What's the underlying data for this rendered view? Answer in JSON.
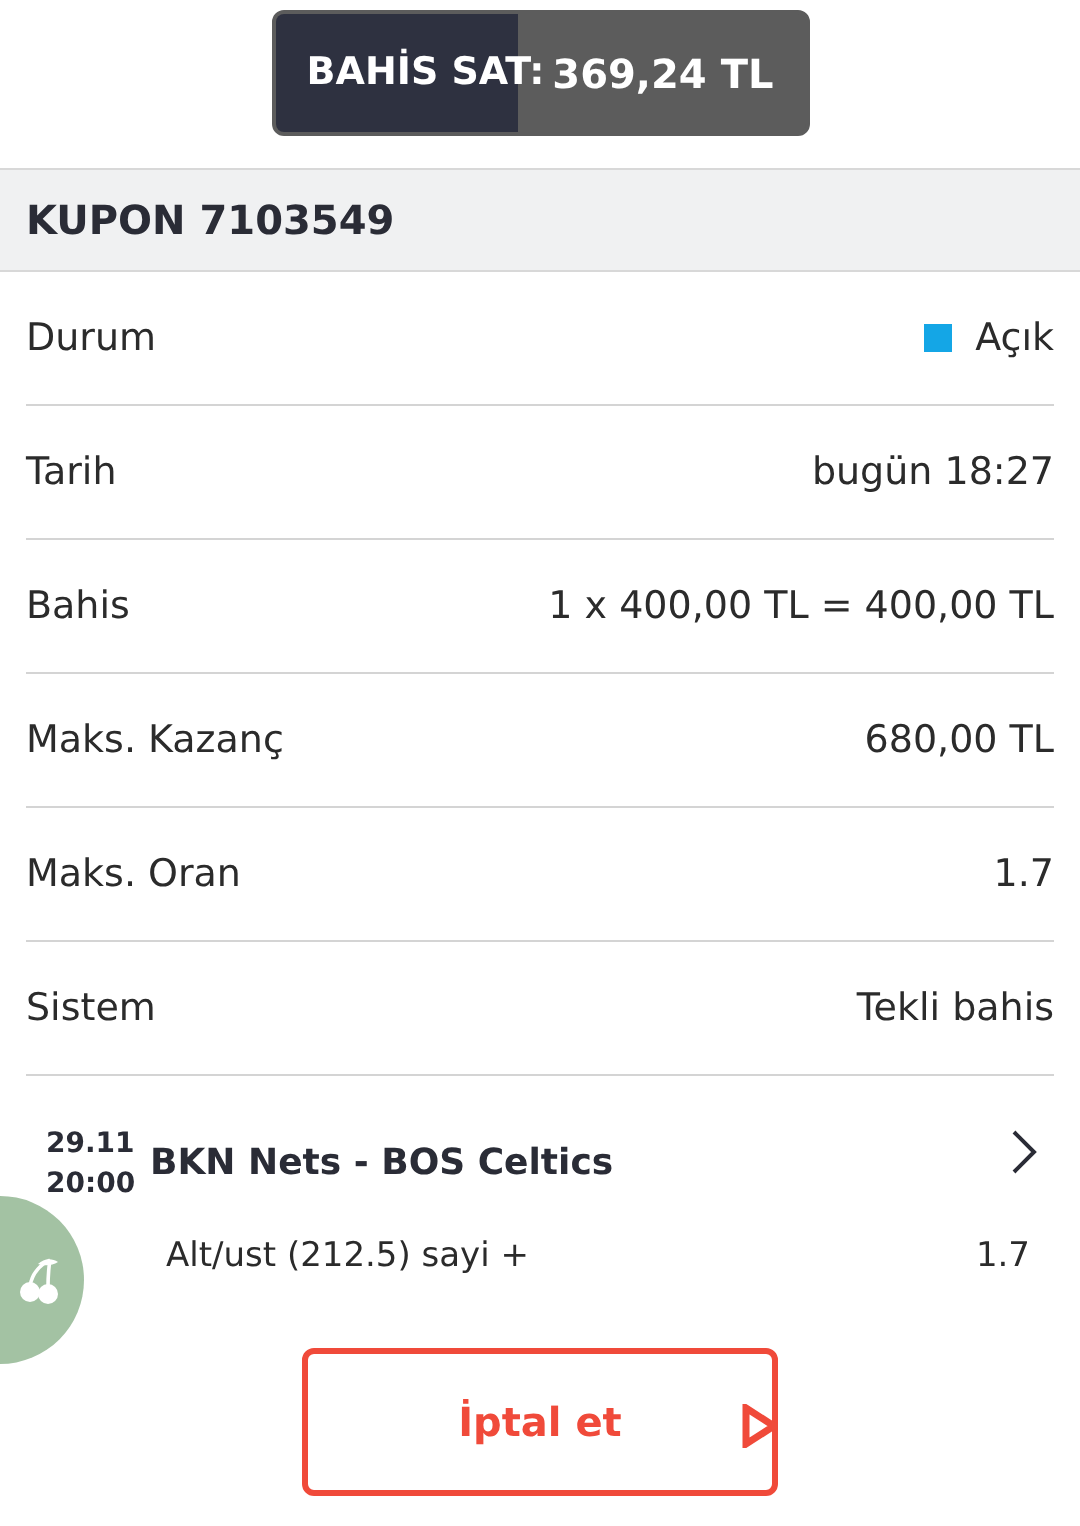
{
  "sell_button": {
    "label": "BAHİS SAT:",
    "amount": "369,24 TL",
    "level": 0.46
  },
  "coupon_title": "KUPON 7103549",
  "details": [
    {
      "label": "Durum",
      "value": "Açık",
      "kind": "status",
      "color": "#14a6e6"
    },
    {
      "label": "Tarih",
      "value": "bugün 18:27",
      "kind": "text"
    },
    {
      "label": "Bahis",
      "value": "1 x 400,00 TL = 400,00 TL",
      "kind": "text"
    },
    {
      "label": "Maks. Kazanç",
      "value": "680,00 TL",
      "kind": "text"
    },
    {
      "label": "Maks. Oran",
      "value": "1.7",
      "kind": "text"
    },
    {
      "label": "Sistem",
      "value": "Tekli bahis",
      "kind": "text"
    }
  ],
  "event": {
    "date": "29.11",
    "time": "20:00",
    "teams": "BKN Nets - BOS Celtics",
    "market": "Alt/ust (212.5) sayi +",
    "odds": "1.7"
  },
  "cancel_button": {
    "label": "İptal et"
  }
}
